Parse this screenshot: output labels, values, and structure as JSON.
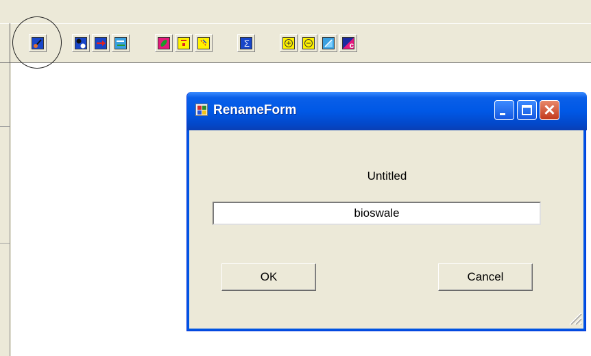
{
  "toolbar": {
    "buttons": [
      {
        "icon": "paint-brush-icon",
        "color": "#1846c9"
      },
      {
        "icon": "node-icon",
        "color": "#1846c9"
      },
      {
        "icon": "arrow-right-icon",
        "color": "#1846c9"
      },
      {
        "icon": "swap-arrows-icon",
        "color": "#3aa0e0"
      },
      {
        "icon": "leaf-icon",
        "color": "#e6197c"
      },
      {
        "icon": "red-dot-icon",
        "color": "#fff200"
      },
      {
        "icon": "line-tool-icon",
        "color": "#fff200"
      },
      {
        "icon": "sum-icon",
        "color": "#1846c9",
        "glyph": "Σ"
      },
      {
        "icon": "zoom-in-icon",
        "color": "#fff200",
        "glyph": "+"
      },
      {
        "icon": "zoom-out-icon",
        "color": "#fff200",
        "glyph": "−"
      },
      {
        "icon": "fit-extent-icon",
        "color": "#3aa0e0"
      },
      {
        "icon": "c-tool-icon",
        "color": "#1a2aa0",
        "glyph": "c"
      }
    ]
  },
  "dialog": {
    "title": "RenameForm",
    "label": "Untitled",
    "input_value": "bioswale",
    "ok_label": "OK",
    "cancel_label": "Cancel",
    "close_glyph": "✕"
  },
  "colors": {
    "titlebar": "#0058e6",
    "dialog_bg": "#ece9d8",
    "close_button": "#c2391c"
  }
}
